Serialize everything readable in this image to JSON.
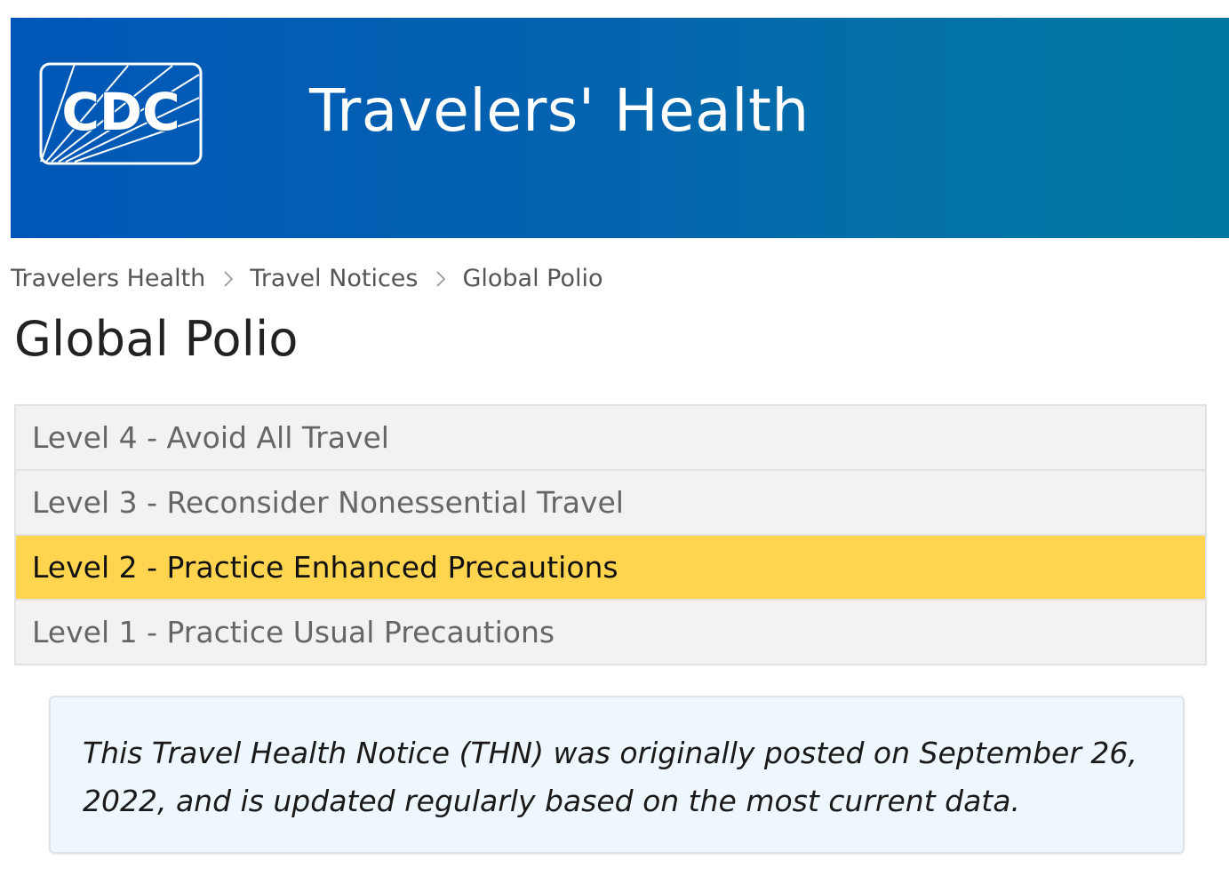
{
  "header": {
    "logo_text": "CDC",
    "title": "Travelers' Health",
    "accent_color": "#0057b7"
  },
  "breadcrumb": {
    "items": [
      "Travelers Health",
      "Travel Notices",
      "Global Polio"
    ],
    "separator_icon": "chevron-right-icon"
  },
  "page": {
    "title": "Global Polio"
  },
  "levels": {
    "items": [
      {
        "label": "Level 4 - Avoid All Travel",
        "active": false
      },
      {
        "label": "Level 3 - Reconsider Nonessential Travel",
        "active": false
      },
      {
        "label": "Level 2 - Practice Enhanced Precautions",
        "active": true
      },
      {
        "label": "Level 1 - Practice Usual Precautions",
        "active": false
      }
    ],
    "active_color": "#ffd54f"
  },
  "notice": {
    "text": "This Travel Health Notice (THN) was originally posted on September 26, 2022, and is updated regularly based on the most current data."
  }
}
